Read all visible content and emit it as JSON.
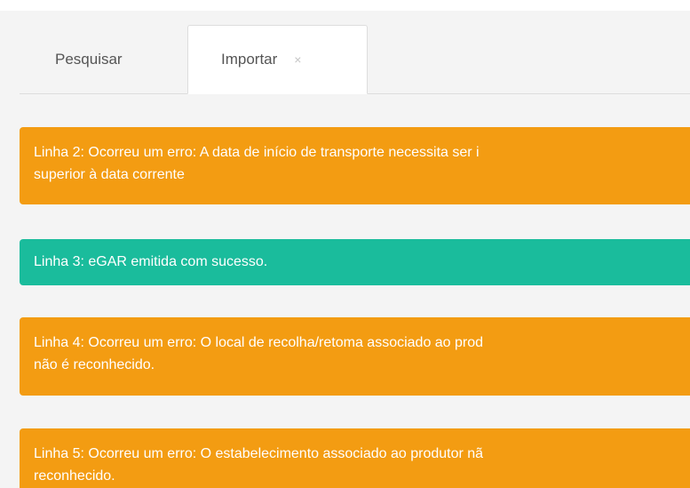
{
  "tabs": [
    {
      "label": "Pesquisar",
      "active": false
    },
    {
      "label": "Importar",
      "active": true,
      "close_glyph": "×"
    }
  ],
  "colors": {
    "warning": "#f39c12",
    "success": "#1abc9c",
    "panel_bg": "#f4f4f4"
  },
  "alerts": [
    {
      "type": "warning",
      "line1": "Linha 2: Ocorreu um erro: A data de início de transporte necessita ser i",
      "line2": "superior à data corrente"
    },
    {
      "type": "success",
      "line1": "Linha 3: eGAR emitida com sucesso."
    },
    {
      "type": "warning",
      "line1": "Linha 4: Ocorreu um erro: O local de recolha/retoma associado ao prod",
      "line2": "não é reconhecido."
    },
    {
      "type": "warning",
      "line1": "Linha 5: Ocorreu um erro: O estabelecimento associado ao produtor nã",
      "line2": "reconhecido."
    }
  ]
}
